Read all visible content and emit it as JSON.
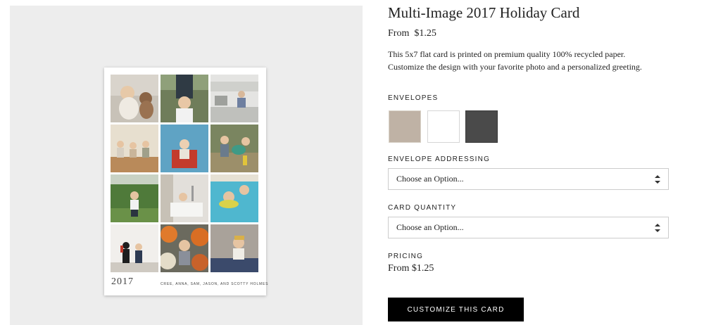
{
  "product": {
    "title": "Multi-Image 2017 Holiday Card",
    "from_price": "From  $1.25",
    "description_lines": [
      "This 5x7 flat card is printed on premium quality 100% recycled paper.",
      "Customize the design with your favorite photo and a personalized greeting."
    ]
  },
  "card_preview": {
    "year": "2017",
    "names": "CREE, ANNA, SAM, JASON, AND SCOTTY HOLMES",
    "photos": [
      {
        "subject": "baby-with-teddy-bear"
      },
      {
        "subject": "parent-holding-toddler"
      },
      {
        "subject": "child-in-kitchen"
      },
      {
        "subject": "three-children-on-bench"
      },
      {
        "subject": "toddler-in-red-chair"
      },
      {
        "subject": "children-outdoors-swing"
      },
      {
        "subject": "child-in-garden"
      },
      {
        "subject": "child-at-sink"
      },
      {
        "subject": "kids-in-pool"
      },
      {
        "subject": "costumed-children"
      },
      {
        "subject": "pumpkins-and-toddler"
      },
      {
        "subject": "toddler-on-blanket"
      }
    ]
  },
  "envelopes": {
    "label": "ENVELOPES",
    "swatches": [
      {
        "name": "kraft",
        "color": "#bfb2a5"
      },
      {
        "name": "white",
        "color": "#ffffff"
      },
      {
        "name": "charcoal",
        "color": "#4a4a4a"
      }
    ]
  },
  "addressing": {
    "label": "ENVELOPE ADDRESSING",
    "selected": "Choose an Option..."
  },
  "quantity": {
    "label": "CARD QUANTITY",
    "selected": "Choose an Option..."
  },
  "pricing": {
    "label": "PRICING",
    "value": "From $1.25"
  },
  "cta": {
    "label": "CUSTOMIZE THIS CARD"
  }
}
